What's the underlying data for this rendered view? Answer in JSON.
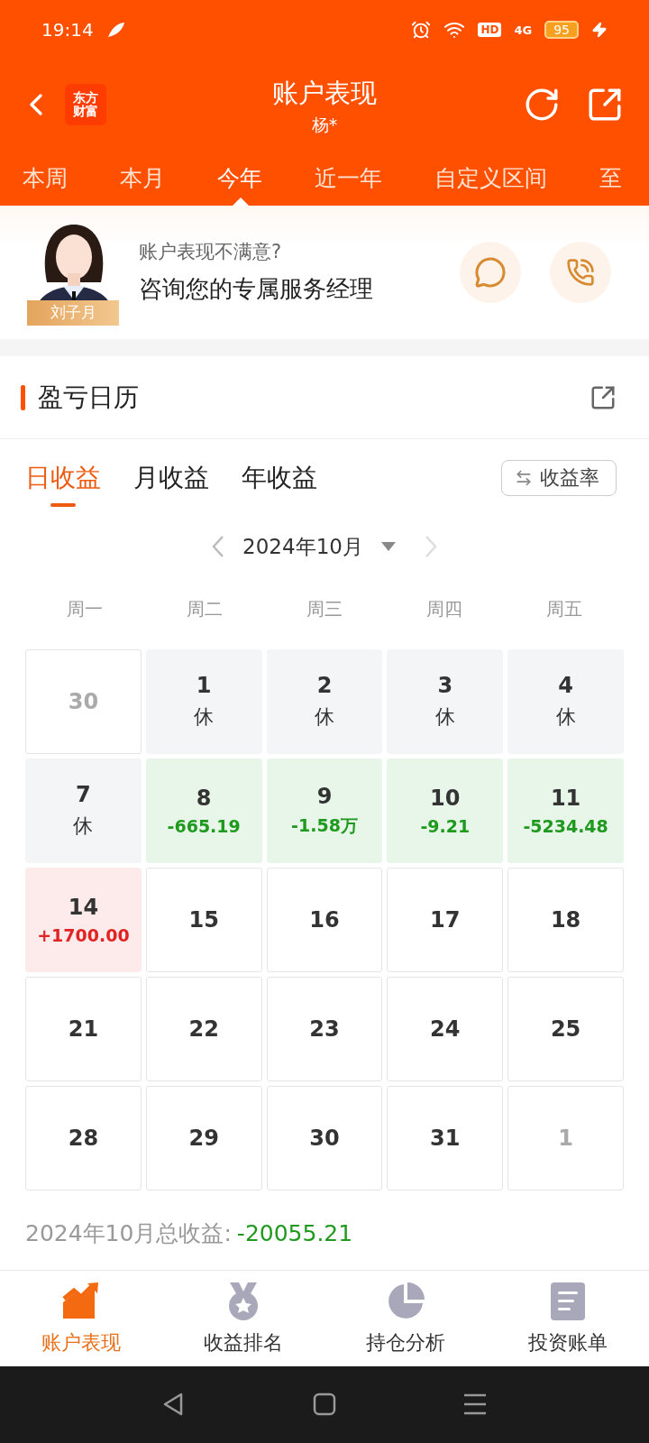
{
  "status_bar": {
    "time": "19:14",
    "hd": "HD",
    "network": "4G",
    "battery": "95"
  },
  "header": {
    "logo_lines": [
      "东方",
      "财富"
    ],
    "title": "账户表现",
    "subtitle": "杨*"
  },
  "period_tabs": [
    {
      "label": "本周",
      "selected": false
    },
    {
      "label": "本月",
      "selected": false
    },
    {
      "label": "今年",
      "selected": true
    },
    {
      "label": "近一年",
      "selected": false
    },
    {
      "label": "自定义区间",
      "selected": false
    },
    {
      "label": "至",
      "selected": false
    }
  ],
  "advisor": {
    "name": "刘子月",
    "question": "账户表现不满意?",
    "prompt": "咨询您的专属服务经理"
  },
  "calendar_card": {
    "title": "盈亏日历",
    "profit_tabs": [
      {
        "label": "日收益",
        "selected": true
      },
      {
        "label": "月收益",
        "selected": false
      },
      {
        "label": "年收益",
        "selected": false
      }
    ],
    "toggle": "收益率",
    "month": "2024年10月",
    "weekdays": [
      "周一",
      "周二",
      "周三",
      "周四",
      "周五"
    ],
    "weeks": [
      [
        {
          "day": "30",
          "kind": "other"
        },
        {
          "day": "1",
          "kind": "holiday",
          "note": "休"
        },
        {
          "day": "2",
          "kind": "holiday",
          "note": "休"
        },
        {
          "day": "3",
          "kind": "holiday",
          "note": "休"
        },
        {
          "day": "4",
          "kind": "holiday",
          "note": "休"
        }
      ],
      [
        {
          "day": "7",
          "kind": "holiday",
          "note": "休"
        },
        {
          "day": "8",
          "kind": "loss",
          "note": "-665.19"
        },
        {
          "day": "9",
          "kind": "loss",
          "note": "-1.58万"
        },
        {
          "day": "10",
          "kind": "loss",
          "note": "-9.21"
        },
        {
          "day": "11",
          "kind": "loss",
          "note": "-5234.48"
        }
      ],
      [
        {
          "day": "14",
          "kind": "gain",
          "note": "+1700.00"
        },
        {
          "day": "15",
          "kind": "plain"
        },
        {
          "day": "16",
          "kind": "plain"
        },
        {
          "day": "17",
          "kind": "plain"
        },
        {
          "day": "18",
          "kind": "plain"
        }
      ],
      [
        {
          "day": "21",
          "kind": "plain"
        },
        {
          "day": "22",
          "kind": "plain"
        },
        {
          "day": "23",
          "kind": "plain"
        },
        {
          "day": "24",
          "kind": "plain"
        },
        {
          "day": "25",
          "kind": "plain"
        }
      ],
      [
        {
          "day": "28",
          "kind": "plain"
        },
        {
          "day": "29",
          "kind": "plain"
        },
        {
          "day": "30",
          "kind": "plain"
        },
        {
          "day": "31",
          "kind": "plain"
        },
        {
          "day": "1",
          "kind": "other"
        }
      ]
    ],
    "summary_label": "2024年10月总收益:",
    "summary_value": "-20055.21"
  },
  "bottom_nav": [
    {
      "label": "账户表现",
      "kind": "chart",
      "selected": true
    },
    {
      "label": "收益排名",
      "kind": "medal",
      "selected": false
    },
    {
      "label": "持仓分析",
      "kind": "pie",
      "selected": false
    },
    {
      "label": "投资账单",
      "kind": "bill",
      "selected": false
    }
  ]
}
